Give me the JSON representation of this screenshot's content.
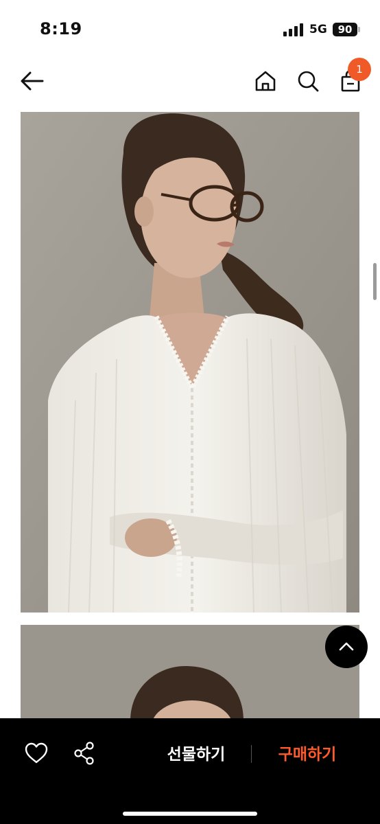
{
  "status_bar": {
    "time": "8:19",
    "network": "5G",
    "battery": "90"
  },
  "header": {
    "cart_count": "1"
  },
  "icons": {
    "back": "arrow-left-icon",
    "home": "home-icon",
    "search": "search-icon",
    "bag": "shopping-bag-icon",
    "scroll_top": "chevron-up-icon",
    "like": "heart-icon",
    "share": "share-icon"
  },
  "colors": {
    "accent": "#f05a28",
    "buy_text": "#ff5a2c",
    "bottom_bar": "#000000"
  },
  "bottom_bar": {
    "gift_label": "선물하기",
    "buy_label": "구매하기"
  }
}
